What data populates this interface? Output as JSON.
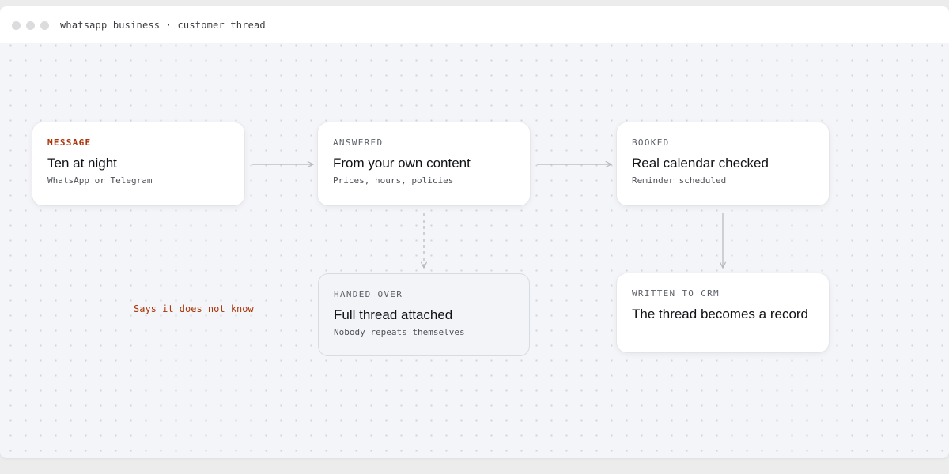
{
  "window": {
    "title": "whatsapp business · customer thread"
  },
  "nodes": {
    "message": {
      "eyebrow": "MESSAGE",
      "heading": "Ten at night",
      "sub": "WhatsApp or Telegram"
    },
    "answered": {
      "eyebrow": "ANSWERED",
      "heading": "From your own content",
      "sub": "Prices, hours, policies"
    },
    "booked": {
      "eyebrow": "BOOKED",
      "heading": "Real calendar checked",
      "sub": "Reminder scheduled"
    },
    "handed": {
      "eyebrow": "HANDED OVER",
      "heading": "Full thread attached",
      "sub": "Nobody repeats themselves"
    },
    "crm": {
      "eyebrow": "WRITTEN TO CRM",
      "heading": "The thread becomes a record"
    }
  },
  "annotations": {
    "fallback_note": "Says it does not know"
  },
  "colors": {
    "accent": "#a8360a",
    "background": "#f4f5f8",
    "card": "#ffffff",
    "arrow": "#b4b7bd"
  }
}
